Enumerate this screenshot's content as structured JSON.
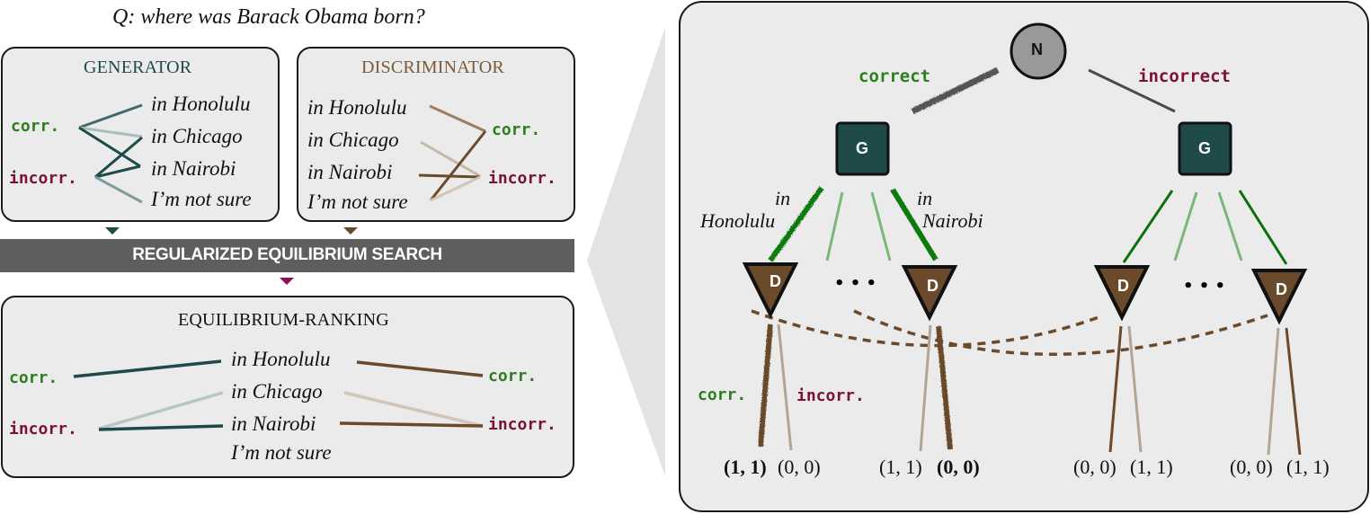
{
  "question": "Q: where was Barack Obama born?",
  "colors": {
    "generator": "#1f4a4a",
    "discriminator": "#6b4a2b",
    "correct_green": "#2e7d1f",
    "incorrect_red": "#7a1230",
    "search_bar": "#5e5e5e",
    "ranking_arrow": "#8e1050",
    "panel_bg": "#ebebeb"
  },
  "candidates": [
    "in Honolulu",
    "in Chicago",
    "in Nairobi",
    "I’m not sure"
  ],
  "labels": {
    "corr": "corr.",
    "incorr": "incorr."
  },
  "generator": {
    "title": "GENERATOR"
  },
  "discriminator": {
    "title": "DISCRIMINATOR"
  },
  "search_bar": {
    "label": "REGULARIZED EQUILIBRIUM SEARCH"
  },
  "ranking": {
    "title": "EQUILIBRIUM-RANKING"
  },
  "tree": {
    "root": "N",
    "generator_node": "G",
    "discriminator_node": "D",
    "branch_correct": "correct",
    "branch_incorrect": "incorrect",
    "action_left": "in\nHonolulu",
    "action_left_l1": "in",
    "action_left_l2": "Honolulu",
    "action_right_l1": "in",
    "action_right_l2": "Nairobi",
    "ellipsis": "• • •",
    "leaf_corr": "corr.",
    "leaf_incorr": "incorr.",
    "payoffs": [
      "(1, 1)",
      "(0, 0)",
      "(1, 1)",
      "(0, 0)",
      "(0, 0)",
      "(1, 1)",
      "(0, 0)",
      "(1, 1)"
    ],
    "payoffs_bold": [
      true,
      false,
      false,
      true,
      false,
      false,
      false,
      false
    ]
  }
}
